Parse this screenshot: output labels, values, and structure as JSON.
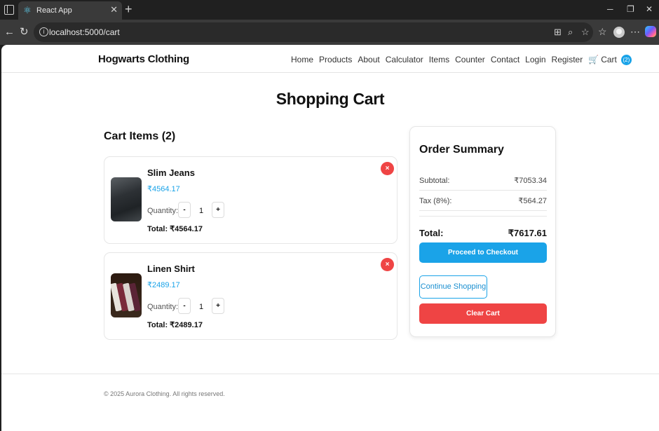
{
  "browser": {
    "tab_title": "React App",
    "tab_close": "✕",
    "new_tab": "+",
    "url": "localhost:5000/cart",
    "window_controls": {
      "minimize": "─",
      "restore": "❐",
      "close": "✕"
    },
    "more_menu": "⋯",
    "icons": [
      "sidebar-icon",
      "react-favicon",
      "back-icon",
      "reload-icon",
      "site-info-icon",
      "split-screen-icon",
      "zoom-icon",
      "favorite-icon",
      "favorites-list-icon",
      "profile-icon",
      "more-icon",
      "copilot-icon"
    ]
  },
  "navbar": {
    "brand": "Hogwarts Clothing",
    "links": [
      "Home",
      "Products",
      "About",
      "Calculator",
      "Items",
      "Counter",
      "Contact",
      "Login",
      "Register"
    ],
    "cart_icon": "🛒",
    "cart_label": "Cart",
    "cart_count": "(2)"
  },
  "page": {
    "title": "Shopping Cart",
    "items_heading": "Cart Items (2)"
  },
  "cart": {
    "items": [
      {
        "name": "Slim Jeans",
        "price": "₹4564.17",
        "quantity_label": "Quantity:",
        "minus": "-",
        "quantity": "1",
        "plus": "+",
        "total": "Total: ₹4564.17",
        "remove": "×"
      },
      {
        "name": "Linen Shirt",
        "price": "₹2489.17",
        "quantity_label": "Quantity:",
        "minus": "-",
        "quantity": "1",
        "plus": "+",
        "total": "Total: ₹2489.17",
        "remove": "×"
      }
    ]
  },
  "summary": {
    "title": "Order Summary",
    "subtotal_label": "Subtotal:",
    "subtotal_value": "₹7053.34",
    "tax_label": "Tax (8%):",
    "tax_value": "₹564.27",
    "total_label": "Total:",
    "total_value": "₹7617.61",
    "checkout_label": "Proceed to Checkout",
    "continue_label": "Continue Shopping",
    "clear_label": "Clear Cart"
  },
  "footer": {
    "text": "© 2025 Aurora Clothing. All rights reserved."
  },
  "colors": {
    "accent": "#1aa3e8",
    "danger": "#ef4444",
    "chrome_bg": "#202020"
  }
}
